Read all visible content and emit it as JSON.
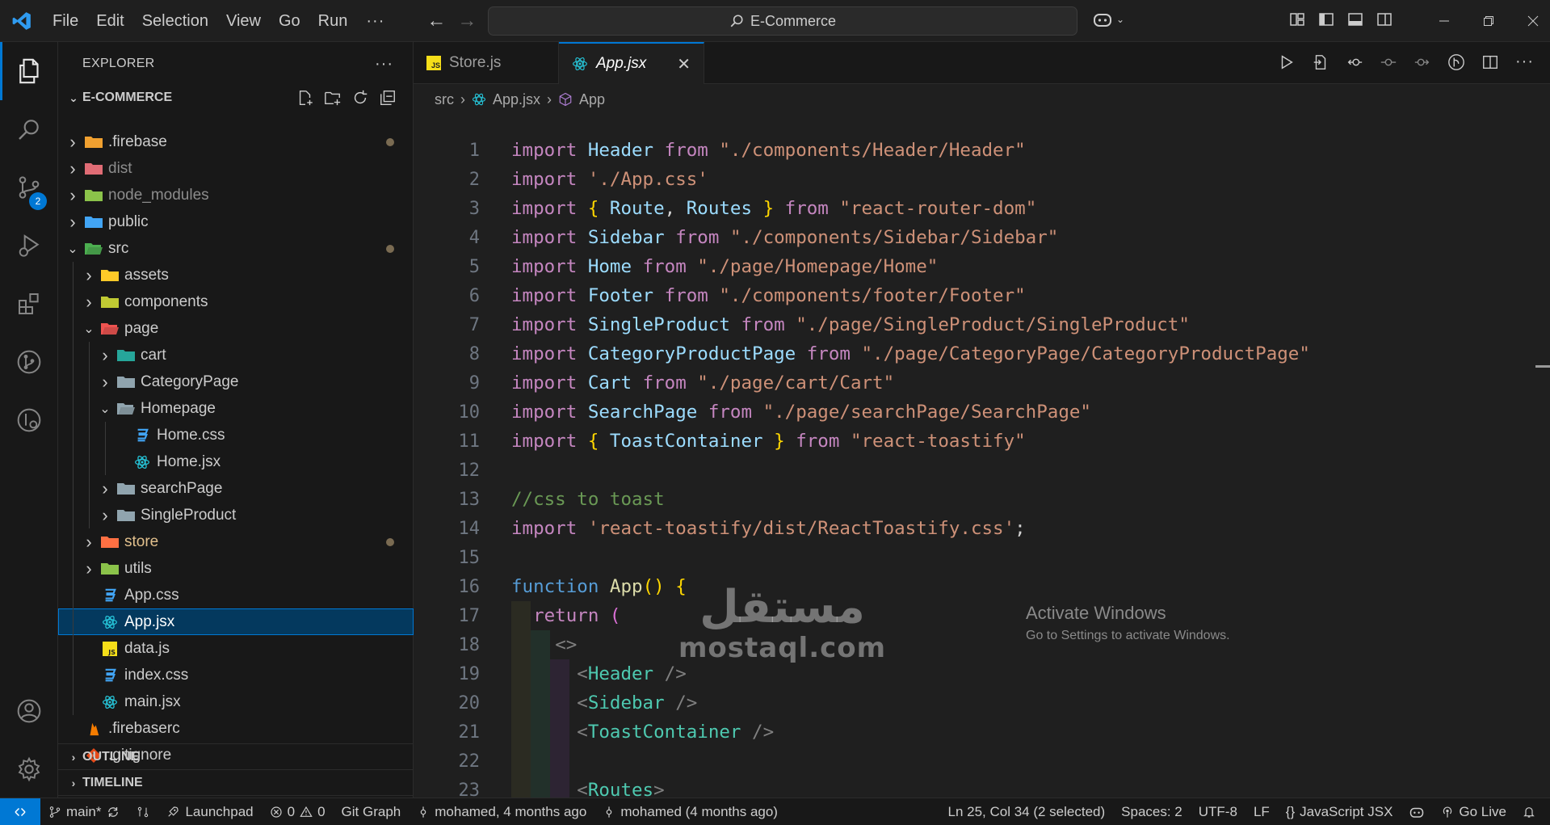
{
  "titlebar": {
    "menu": [
      "File",
      "Edit",
      "Selection",
      "View",
      "Go",
      "Run"
    ],
    "more": "···",
    "search_text": "E-Commerce"
  },
  "activity": {
    "source_control_badge": "2"
  },
  "explorer": {
    "title": "EXPLORER",
    "project": "E-COMMERCE",
    "tree": [
      {
        "label": ".firebase",
        "depth": 0,
        "kind": "folder",
        "open": false,
        "icon": "firebase-folder-icon",
        "color": "#f0a030",
        "dot": true
      },
      {
        "label": "dist",
        "depth": 0,
        "kind": "folder",
        "open": false,
        "icon": "dist-folder-icon",
        "color": "#e06c75",
        "dim": true
      },
      {
        "label": "node_modules",
        "depth": 0,
        "kind": "folder",
        "open": false,
        "icon": "node-folder-icon",
        "color": "#8bc34a",
        "dim": true
      },
      {
        "label": "public",
        "depth": 0,
        "kind": "folder",
        "open": false,
        "icon": "public-folder-icon",
        "color": "#42a5f5"
      },
      {
        "label": "src",
        "depth": 0,
        "kind": "folder",
        "open": true,
        "icon": "src-folder-icon",
        "color": "#4caf50",
        "dot": true
      },
      {
        "label": "assets",
        "depth": 1,
        "kind": "folder",
        "open": false,
        "icon": "assets-folder-icon",
        "color": "#ffca28"
      },
      {
        "label": "components",
        "depth": 1,
        "kind": "folder",
        "open": false,
        "icon": "components-folder-icon",
        "color": "#c0ca33"
      },
      {
        "label": "page",
        "depth": 1,
        "kind": "folder",
        "open": true,
        "icon": "page-folder-icon",
        "color": "#ef5350"
      },
      {
        "label": "cart",
        "depth": 2,
        "kind": "folder",
        "open": false,
        "icon": "cart-folder-icon",
        "color": "#26a69a"
      },
      {
        "label": "CategoryPage",
        "depth": 2,
        "kind": "folder",
        "open": false,
        "icon": "folder-icon",
        "color": "#90a4ae"
      },
      {
        "label": "Homepage",
        "depth": 2,
        "kind": "folder",
        "open": true,
        "icon": "folder-open-icon",
        "color": "#90a4ae"
      },
      {
        "label": "Home.css",
        "depth": 3,
        "kind": "file",
        "icon": "css-file-icon",
        "color": "#42a5f5"
      },
      {
        "label": "Home.jsx",
        "depth": 3,
        "kind": "file",
        "icon": "react-file-icon",
        "color": "#26c6da"
      },
      {
        "label": "searchPage",
        "depth": 2,
        "kind": "folder",
        "open": false,
        "icon": "folder-icon",
        "color": "#90a4ae"
      },
      {
        "label": "SingleProduct",
        "depth": 2,
        "kind": "folder",
        "open": false,
        "icon": "folder-icon",
        "color": "#90a4ae"
      },
      {
        "label": "store",
        "depth": 1,
        "kind": "folder",
        "open": false,
        "icon": "store-folder-icon",
        "color": "#ff7043",
        "dot": true,
        "git": true
      },
      {
        "label": "utils",
        "depth": 1,
        "kind": "folder",
        "open": false,
        "icon": "utils-folder-icon",
        "color": "#8bc34a"
      },
      {
        "label": "App.css",
        "depth": 1,
        "kind": "file",
        "icon": "css-file-icon",
        "color": "#42a5f5"
      },
      {
        "label": "App.jsx",
        "depth": 1,
        "kind": "file",
        "icon": "react-file-icon",
        "color": "#26c6da",
        "selected": true
      },
      {
        "label": "data.js",
        "depth": 1,
        "kind": "file",
        "icon": "js-file-icon",
        "color": "#f5de19"
      },
      {
        "label": "index.css",
        "depth": 1,
        "kind": "file",
        "icon": "css-file-icon",
        "color": "#42a5f5"
      },
      {
        "label": "main.jsx",
        "depth": 1,
        "kind": "file",
        "icon": "react-file-icon",
        "color": "#26c6da"
      },
      {
        "label": ".firebaserc",
        "depth": 0,
        "kind": "file",
        "icon": "firebase-file-icon",
        "color": "#f57c00"
      },
      {
        "label": ".gitignore",
        "depth": 0,
        "kind": "file",
        "icon": "git-file-icon",
        "color": "#e64a19"
      }
    ],
    "outline": "OUTLINE",
    "timeline": "TIMELINE"
  },
  "tabs": [
    {
      "label": "Store.js",
      "icon": "js-file-icon",
      "active": false
    },
    {
      "label": "App.jsx",
      "icon": "react-file-icon",
      "active": true
    }
  ],
  "breadcrumb": {
    "folder": "src",
    "file": "App.jsx",
    "symbol": "App"
  },
  "code_lines": [
    [
      [
        "k",
        "import "
      ],
      [
        "id",
        "Header "
      ],
      [
        "k",
        "from "
      ],
      [
        "s",
        "\"./components/Header/Header\""
      ]
    ],
    [
      [
        "k",
        "import "
      ],
      [
        "s",
        "'./App.css'"
      ]
    ],
    [
      [
        "k",
        "import "
      ],
      [
        "br",
        "{ "
      ],
      [
        "id",
        "Route"
      ],
      [
        "pl",
        ", "
      ],
      [
        "id",
        "Routes "
      ],
      [
        "br",
        "} "
      ],
      [
        "k",
        "from "
      ],
      [
        "s",
        "\"react-router-dom\""
      ]
    ],
    [
      [
        "k",
        "import "
      ],
      [
        "id",
        "Sidebar "
      ],
      [
        "k",
        "from "
      ],
      [
        "s",
        "\"./components/Sidebar/Sidebar\""
      ]
    ],
    [
      [
        "k",
        "import "
      ],
      [
        "id",
        "Home "
      ],
      [
        "k",
        "from "
      ],
      [
        "s",
        "\"./page/Homepage/Home\""
      ]
    ],
    [
      [
        "k",
        "import "
      ],
      [
        "id",
        "Footer "
      ],
      [
        "k",
        "from "
      ],
      [
        "s",
        "\"./components/footer/Footer\""
      ]
    ],
    [
      [
        "k",
        "import "
      ],
      [
        "id",
        "SingleProduct "
      ],
      [
        "k",
        "from "
      ],
      [
        "s",
        "\"./page/SingleProduct/SingleProduct\""
      ]
    ],
    [
      [
        "k",
        "import "
      ],
      [
        "id",
        "CategoryProductPage "
      ],
      [
        "k",
        "from "
      ],
      [
        "s",
        "\"./page/CategoryPage/CategoryProductPage\""
      ]
    ],
    [
      [
        "k",
        "import "
      ],
      [
        "id",
        "Cart "
      ],
      [
        "k",
        "from "
      ],
      [
        "s",
        "\"./page/cart/Cart\""
      ]
    ],
    [
      [
        "k",
        "import "
      ],
      [
        "id",
        "SearchPage "
      ],
      [
        "k",
        "from "
      ],
      [
        "s",
        "\"./page/searchPage/SearchPage\""
      ]
    ],
    [
      [
        "k",
        "import "
      ],
      [
        "br",
        "{ "
      ],
      [
        "id",
        "ToastContainer "
      ],
      [
        "br",
        "} "
      ],
      [
        "k",
        "from "
      ],
      [
        "s",
        "\"react-toastify\""
      ]
    ],
    [],
    [
      [
        "c",
        "//css to toast"
      ]
    ],
    [
      [
        "k",
        "import "
      ],
      [
        "s",
        "'react-toastify/dist/ReactToastify.css'"
      ],
      [
        "pl",
        ";"
      ]
    ],
    [],
    [
      [
        "kb",
        "function "
      ],
      [
        "fn",
        "App"
      ],
      [
        "br",
        "() {"
      ]
    ],
    [
      [
        "pl",
        "  "
      ],
      [
        "k",
        "return "
      ],
      [
        "br2",
        "("
      ]
    ],
    [
      [
        "pl",
        "    "
      ],
      [
        "pu",
        "<>"
      ]
    ],
    [
      [
        "pl",
        "      "
      ],
      [
        "pu",
        "<"
      ],
      [
        "tg",
        "Header "
      ],
      [
        "pu",
        "/>"
      ]
    ],
    [
      [
        "pl",
        "      "
      ],
      [
        "pu",
        "<"
      ],
      [
        "tg",
        "Sidebar "
      ],
      [
        "pu",
        "/>"
      ]
    ],
    [
      [
        "pl",
        "      "
      ],
      [
        "pu",
        "<"
      ],
      [
        "tg",
        "ToastContainer "
      ],
      [
        "pu",
        "/>"
      ]
    ],
    [],
    [
      [
        "pl",
        "      "
      ],
      [
        "pu",
        "<"
      ],
      [
        "tg",
        "Routes"
      ],
      [
        "pu",
        ">"
      ]
    ]
  ],
  "watermark": {
    "title": "Activate Windows",
    "subtitle": "Go to Settings to activate Windows.",
    "logo_ar": "مستقل",
    "logo_lat": "mostaql.com"
  },
  "status": {
    "branch": "main*",
    "launchpad": "Launchpad",
    "errors": "0",
    "warnings": "0",
    "git_graph": "Git Graph",
    "blame1": "mohamed, 4 months ago",
    "blame2": "mohamed (4 months ago)",
    "position": "Ln 25, Col 34 (2 selected)",
    "spaces": "Spaces: 2",
    "encoding": "UTF-8",
    "eol": "LF",
    "language": "JavaScript JSX",
    "golive": "Go Live"
  }
}
